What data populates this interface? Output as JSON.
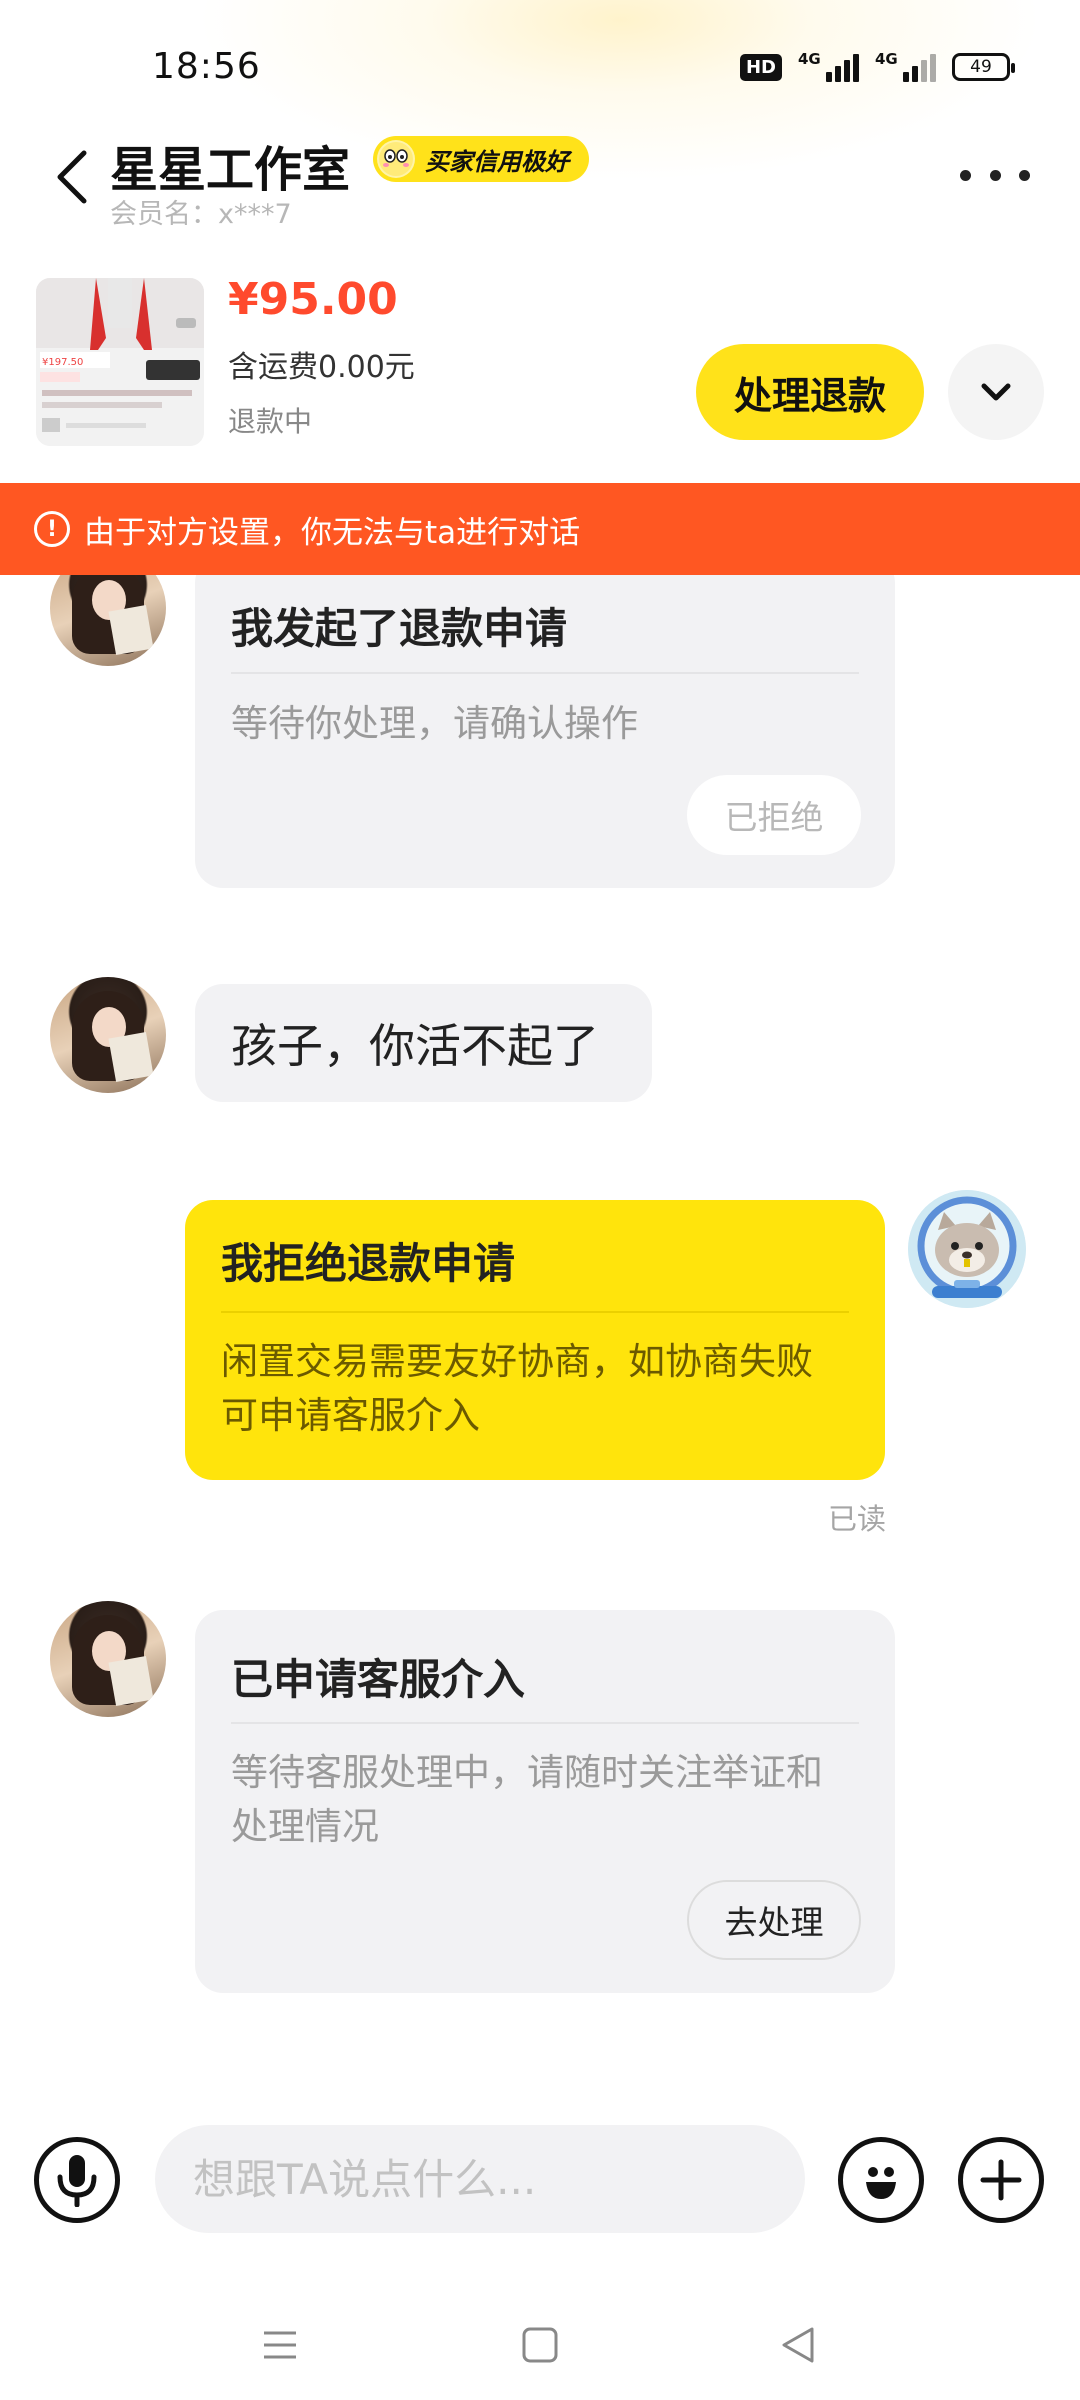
{
  "status_bar": {
    "time": "18:56",
    "hd": "HD",
    "network1": "4G",
    "network2": "4G",
    "battery": "49"
  },
  "header": {
    "shop_name": "星星工作室",
    "credit_badge": "买家信用极好",
    "member_label": "会员名：",
    "member_id": "x***7"
  },
  "product": {
    "price": "¥95.00",
    "shipping": "含运费0.00元",
    "status": "退款中",
    "thumb_text": "¥197.50",
    "process_button": "处理退款"
  },
  "notice": {
    "text": "由于对方设置，你无法与ta进行对话"
  },
  "messages": {
    "refund_request": {
      "title": "我发起了退款申请",
      "desc": "等待你处理，请确认操作",
      "button": "已拒绝"
    },
    "text_message": {
      "text": "孩子，你活不起了"
    },
    "reject_card": {
      "title": "我拒绝退款申请",
      "desc": "闲置交易需要友好协商，如协商失败可申请客服介入",
      "read": "已读"
    },
    "service_card": {
      "title": "已申请客服介入",
      "desc": "等待客服处理中，请随时关注举证和处理情况",
      "button": "去处理"
    }
  },
  "input": {
    "placeholder": "想跟TA说点什么..."
  },
  "colors": {
    "accent_yellow": "#ffe21a",
    "price_red": "#ff4a2d",
    "notice_orange": "#ff5722"
  }
}
